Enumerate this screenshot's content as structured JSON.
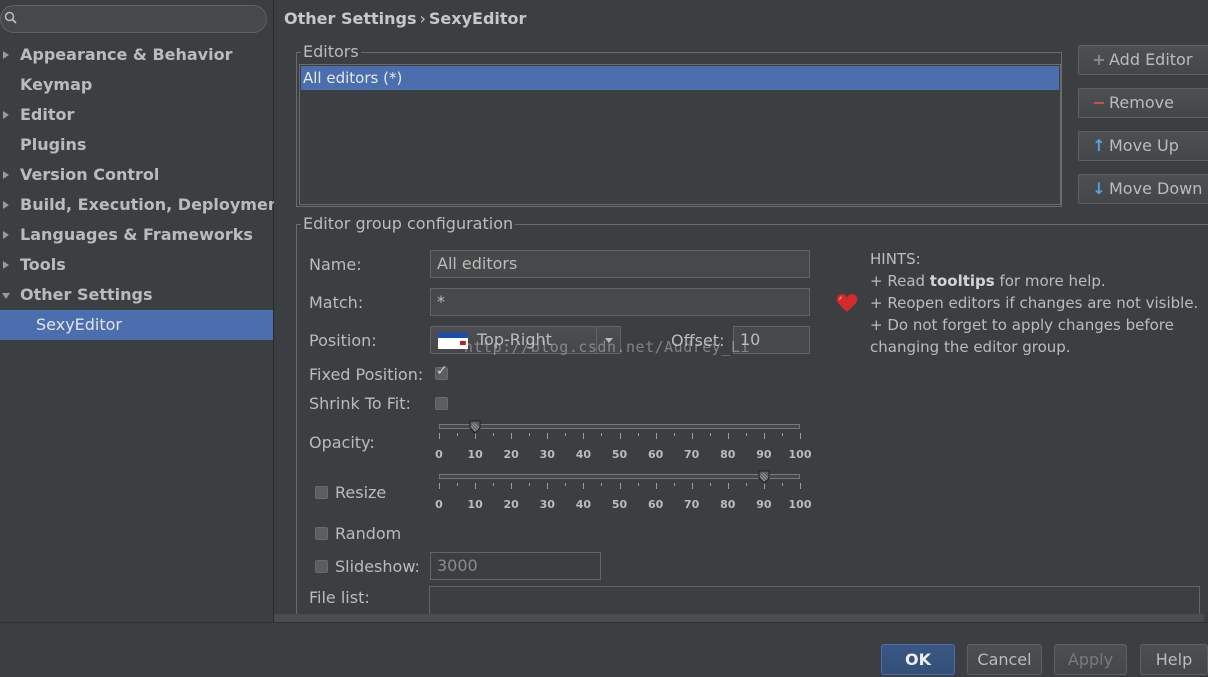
{
  "search": {
    "placeholder": ""
  },
  "sidebar": {
    "items": [
      {
        "label": "Appearance & Behavior",
        "expandable": true,
        "expanded": false
      },
      {
        "label": "Keymap",
        "expandable": false
      },
      {
        "label": "Editor",
        "expandable": true,
        "expanded": false
      },
      {
        "label": "Plugins",
        "expandable": false
      },
      {
        "label": "Version Control",
        "expandable": true,
        "expanded": false
      },
      {
        "label": "Build, Execution, Deployment",
        "expandable": true,
        "expanded": false
      },
      {
        "label": "Languages & Frameworks",
        "expandable": true,
        "expanded": false
      },
      {
        "label": "Tools",
        "expandable": true,
        "expanded": false
      },
      {
        "label": "Other Settings",
        "expandable": true,
        "expanded": true
      },
      {
        "label": "SexyEditor",
        "child": true,
        "selected": true
      }
    ]
  },
  "breadcrumb": {
    "parent": "Other Settings",
    "separator": "›",
    "current": "SexyEditor"
  },
  "editors": {
    "title": "Editors",
    "items": [
      "All editors (*)"
    ],
    "buttons": {
      "add": "Add Editor",
      "remove": "Remove",
      "move_up": "Move Up",
      "move_down": "Move Down"
    }
  },
  "config": {
    "title": "Editor group configuration",
    "name_label": "Name:",
    "name_value": "All editors",
    "match_label": "Match:",
    "match_value": "*",
    "position_label": "Position:",
    "position_value": "Top-Right",
    "offset_label": "Offset:",
    "offset_value": "10",
    "fixed_position_label": "Fixed Position:",
    "fixed_position_checked": true,
    "shrink_label": "Shrink To Fit:",
    "shrink_checked": false,
    "opacity_label": "Opacity:",
    "opacity_value": 10,
    "resize_label": "Resize",
    "resize_checked": false,
    "resize_value": 90,
    "random_label": "Random",
    "random_checked": false,
    "slideshow_label": "Slideshow:",
    "slideshow_checked": false,
    "slideshow_value": "3000",
    "file_list_label": "File list:",
    "slider_ticks": [
      "0",
      "10",
      "20",
      "30",
      "40",
      "50",
      "60",
      "70",
      "80",
      "90",
      "100"
    ]
  },
  "hints": {
    "title": "HINTS:",
    "line1_prefix": "+ Read ",
    "line1_bold": "tooltips",
    "line1_suffix": " for more help.",
    "line2": "+ Reopen editors if changes are not visible.",
    "line3": "+ Do not forget to apply changes before",
    "line4": "changing the editor group."
  },
  "watermark": "http://blog.csdn.net/Audrey_Li",
  "dialog": {
    "ok": "OK",
    "cancel": "Cancel",
    "apply": "Apply",
    "help": "Help"
  },
  "colors": {
    "background": "#3c3f41",
    "selection": "#4b6eaf",
    "text": "#bbbbbb",
    "heart": "#d42a2a"
  }
}
